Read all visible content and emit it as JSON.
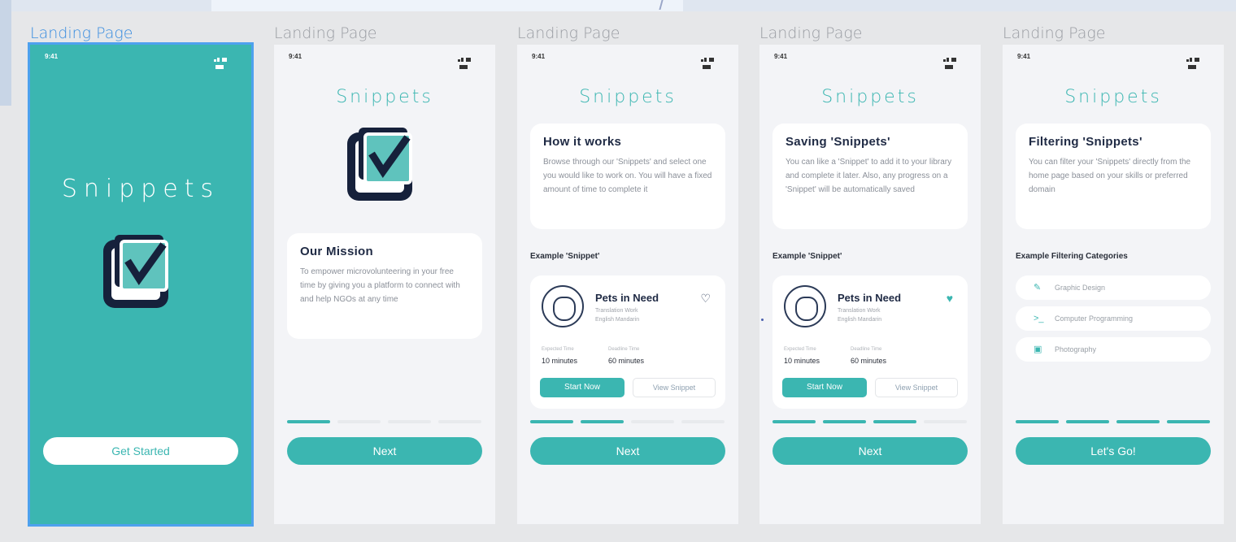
{
  "labels": [
    "Landing Page",
    "Landing Page",
    "Landing Page",
    "Landing Page",
    "Landing Page"
  ],
  "status_time": "9:41",
  "brand": "Snippets",
  "screen1": {
    "cta": "Get Started"
  },
  "screen2": {
    "card_title": "Our Mission",
    "card_text": "To empower microvolunteering in your free time by giving you a platform to connect with and help NGOs at any time",
    "cta": "Next"
  },
  "screen3": {
    "card_title": "How it works",
    "card_text": "Browse through our 'Snippets' and select one you would like to work on. You will have a fixed amount of time to complete it",
    "section": "Example 'Snippet'",
    "cta": "Next"
  },
  "screen4": {
    "card_title": "Saving 'Snippets'",
    "card_text": "You can like a 'Snippet' to add it to your library and complete it later. Also, any progress on a 'Snippet' will be automatically saved",
    "section": "Example 'Snippet'",
    "cta": "Next"
  },
  "screen5": {
    "card_title": "Filtering 'Snippets'",
    "card_text": "You can filter your 'Snippets' directly from the home page based on your skills or preferred domain",
    "section": "Example Filtering Categories",
    "categories": [
      "Graphic Design",
      "Computer Programming",
      "Photography"
    ],
    "cta": "Let's Go!"
  },
  "snippet": {
    "title": "Pets in Need",
    "meta1": "Translation Work",
    "meta2": "English Mandarin",
    "label1": "Expected Time",
    "label2": "Deadline Time",
    "value1": "10 minutes",
    "value2": "60 minutes",
    "start": "Start Now",
    "view": "View Snippet"
  },
  "progress": {
    "total_steps": 4,
    "screen2_active": 1,
    "screen3_active": 2,
    "screen4_active": 3,
    "screen5_active": 4
  },
  "colors": {
    "teal": "#3bb6b1",
    "navy": "#1f2a44",
    "selection": "#4ea1ee"
  }
}
